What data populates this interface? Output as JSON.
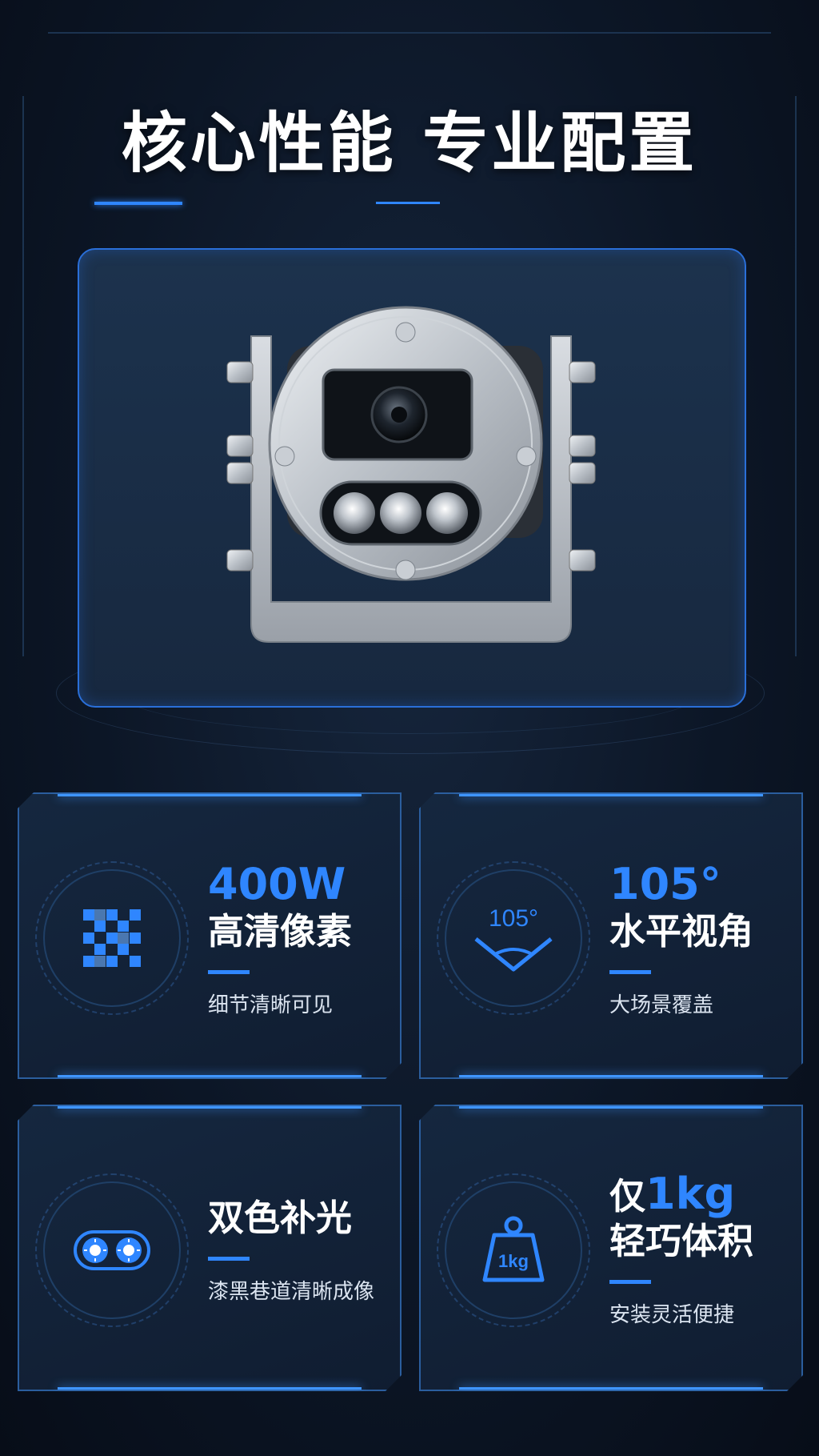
{
  "page": {
    "title": "核心性能 专业配置"
  },
  "colors": {
    "accent": "#2f86ff",
    "background": "#0c1626",
    "card_border": "#2b5e9e",
    "hero_border": "#2a6fd9"
  },
  "hero": {
    "image_description_icon": "explosion-proof-camera-image"
  },
  "features": [
    {
      "icon": "pixel-grid-icon",
      "highlight": "400W",
      "title": "高清像素",
      "desc": "细节清晰可见"
    },
    {
      "icon": "viewing-angle-icon",
      "icon_text": "105°",
      "highlight": "105°",
      "title": "水平视角",
      "desc": "大场景覆盖"
    },
    {
      "icon": "dual-light-icon",
      "title": "双色补光",
      "desc": "漆黑巷道清晰成像"
    },
    {
      "icon": "weight-icon",
      "icon_text": "1kg",
      "title_prefix": "仅",
      "title_highlight": "1kg",
      "title_line2": "轻巧体积",
      "desc": "安装灵活便捷"
    }
  ]
}
